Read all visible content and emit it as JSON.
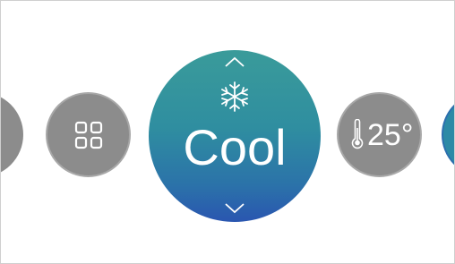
{
  "mode_selector": {
    "current_mode": "Cool",
    "mode_icon": "snowflake-icon",
    "up_icon": "chevron-up-icon",
    "down_icon": "chevron-down-icon"
  },
  "apps_button": {
    "icon": "grid-icon"
  },
  "temperature": {
    "icon": "thermometer-icon",
    "value": "25°"
  },
  "colors": {
    "mode_gradient_top": "#3a9b9a",
    "mode_gradient_bottom": "#2a56b0",
    "inactive_button": "#8c8c8c",
    "text": "#ffffff"
  }
}
